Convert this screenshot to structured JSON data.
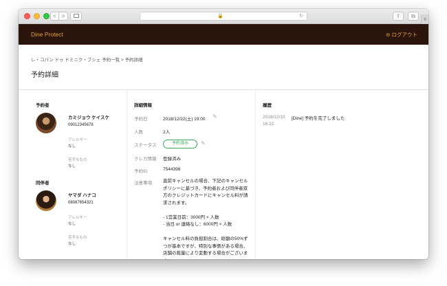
{
  "browser": {
    "back": "<",
    "forward": ">",
    "lock": "🔒",
    "reload": "↻",
    "share": "⇪",
    "tabs": "⧉",
    "new_tab": "+"
  },
  "app": {
    "brand": "Dine Protect",
    "logout": "ログアウト"
  },
  "breadcrumb": "レ・コパン ドゥ ドミニク・ブシェ 予約一覧 > 予約詳細",
  "page_title": "予約詳細",
  "booker": {
    "section": "予約者",
    "name": "カミジョウ ケイスケ",
    "phone": "09012345678",
    "allergy_label": "アレルギー",
    "allergy_value": "なし",
    "dislike_label": "苦手なもの",
    "dislike_value": "なし"
  },
  "companion": {
    "section": "同伴者",
    "name": "ヤマダ ハナコ",
    "phone": "08087654321",
    "allergy_label": "アレルギー",
    "allergy_value": "なし",
    "dislike_label": "苦手なもの",
    "dislike_value": "なし"
  },
  "details": {
    "section": "詳細情報",
    "date_label": "予約日",
    "date_value": "2018/12/22(土) 19:00",
    "people_label": "人数",
    "people_value": "2人",
    "status_label": "ステータス",
    "status_value": "予約済み",
    "card_label": "クレカ情報",
    "card_value": "登録済み",
    "id_label": "予約ID",
    "id_value": "7544398",
    "notes_label": "注意事項",
    "notes_p1": "直前キャンセルの場合、下記のキャンセルポリシーに基づき、予約者および同伴者双方のクレジットカードにキャンセル料が請求されます。",
    "notes_p2a": "- 1営業日前：3000円 × 人数",
    "notes_p2b": "- 当日 or 連絡なし：6000円 × 人数",
    "notes_p3": "キャンセル料の負担割合は、総額の50%ずつが基本ですが、特別な事情がある場合、店舗の裁量により変動する場合がございます。"
  },
  "history": {
    "section": "履歴",
    "date": "2018/12/10 16:22",
    "text": "[Dine] 予約を完了しました"
  },
  "colors": {
    "header_bg": "#2a140c",
    "accent": "#e8a13a",
    "status": "#3aa85b"
  }
}
